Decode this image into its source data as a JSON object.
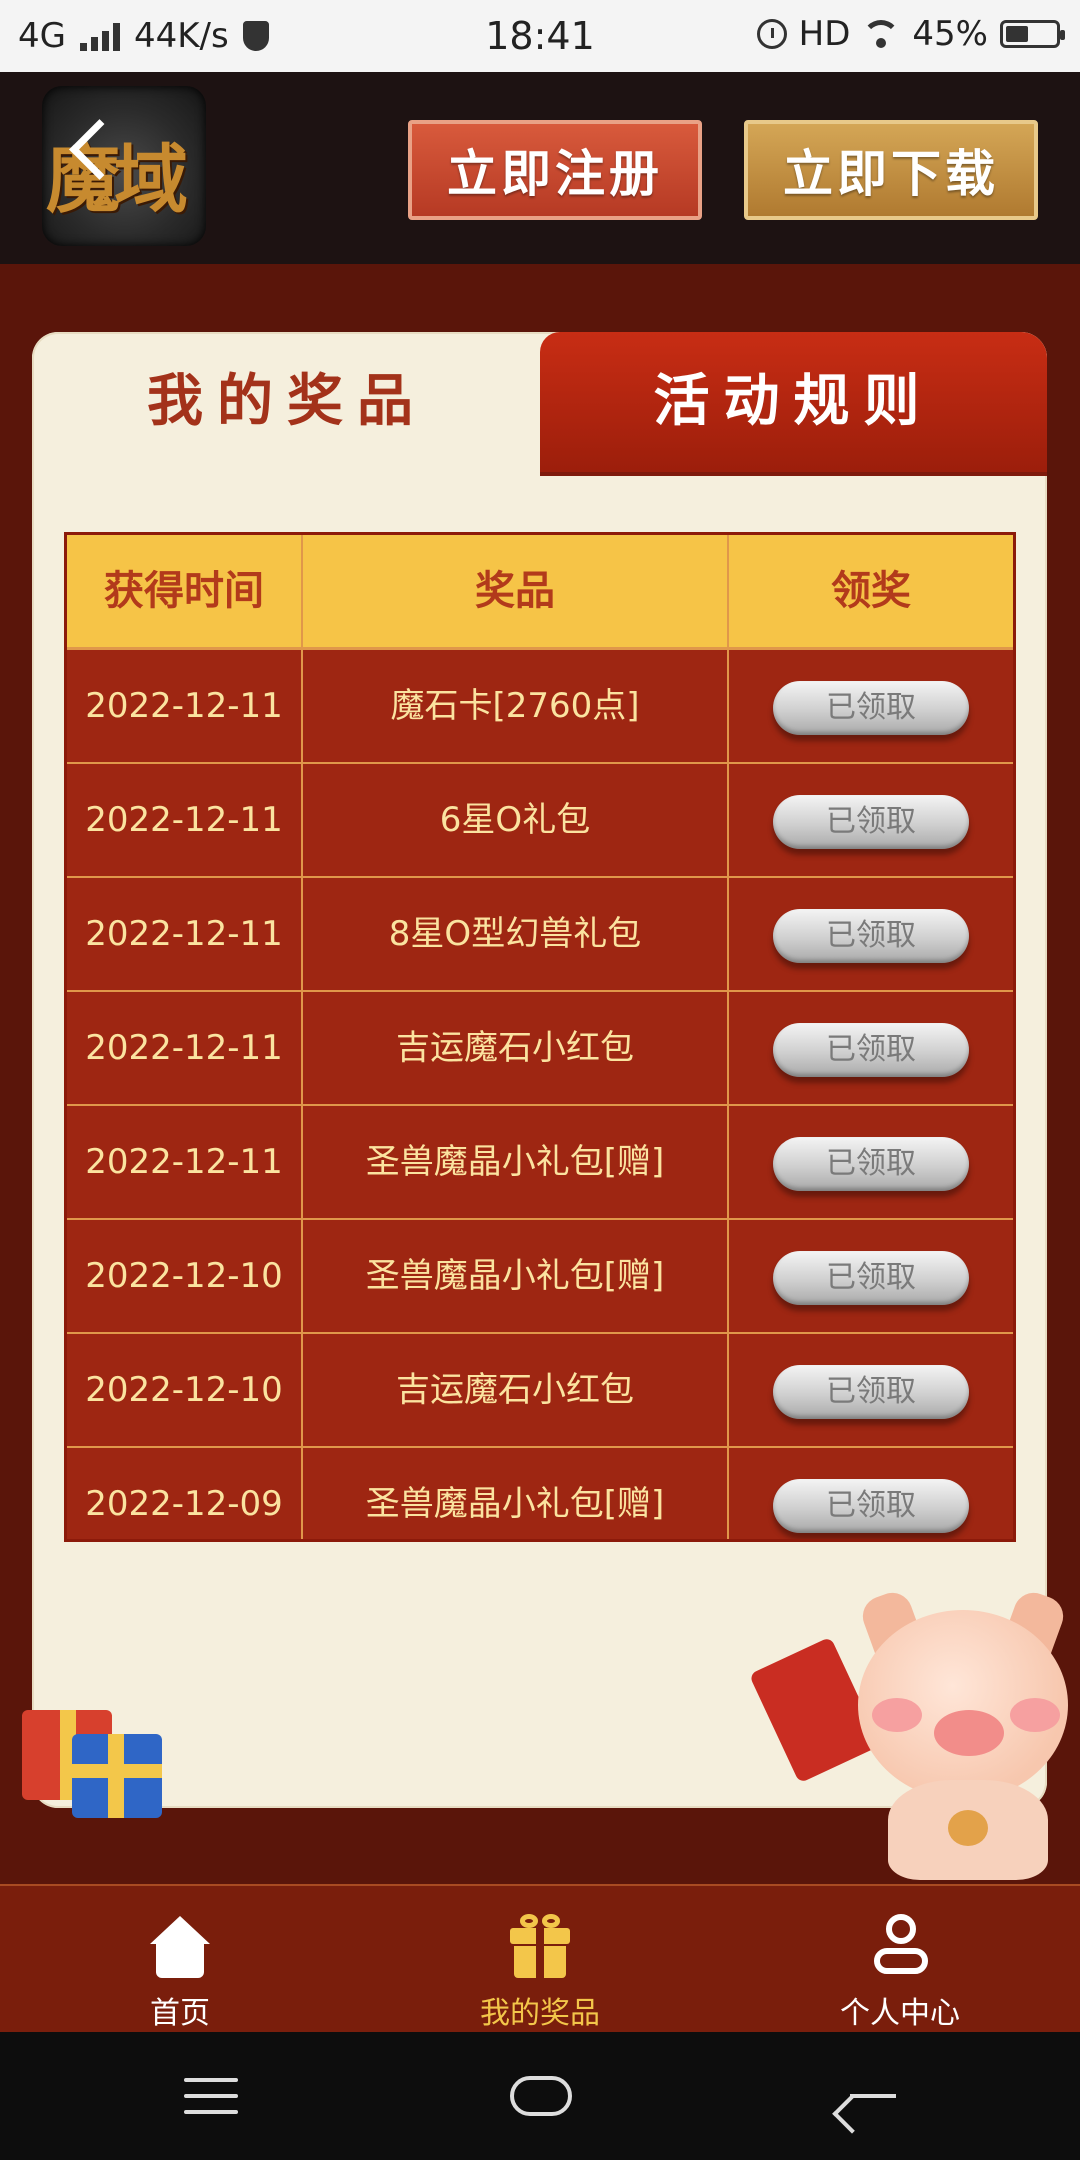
{
  "status_bar": {
    "network": "4G",
    "speed": "44K/s",
    "time": "18:41",
    "hd": "HD",
    "battery": "45%",
    "battery_level": 0.45
  },
  "header": {
    "logo_text": "魔域",
    "register_label": "立即注册",
    "download_label": "立即下载"
  },
  "tabs": {
    "my_prizes": "我的奖品",
    "rules": "活动规则"
  },
  "table": {
    "headers": [
      "获得时间",
      "奖品",
      "领奖"
    ],
    "rows": [
      {
        "date": "2022-12-11",
        "prize": "魔石卡[2760点]",
        "status": "已领取"
      },
      {
        "date": "2022-12-11",
        "prize": "6星O礼包",
        "status": "已领取"
      },
      {
        "date": "2022-12-11",
        "prize": "8星O型幻兽礼包",
        "status": "已领取"
      },
      {
        "date": "2022-12-11",
        "prize": "吉运魔石小红包",
        "status": "已领取"
      },
      {
        "date": "2022-12-11",
        "prize": "圣兽魔晶小礼包[赠]",
        "status": "已领取"
      },
      {
        "date": "2022-12-10",
        "prize": "圣兽魔晶小礼包[赠]",
        "status": "已领取"
      },
      {
        "date": "2022-12-10",
        "prize": "吉运魔石小红包",
        "status": "已领取"
      },
      {
        "date": "2022-12-09",
        "prize": "圣兽魔晶小礼包[赠]",
        "status": "已领取"
      }
    ]
  },
  "bottom_nav": {
    "home": "首页",
    "my_prizes": "我的奖品",
    "user_center": "个人中心"
  },
  "colors": {
    "accent_red": "#c82d14",
    "gold": "#f6c447",
    "table_bg": "#9e2612",
    "active_nav": "#f3c64a"
  }
}
